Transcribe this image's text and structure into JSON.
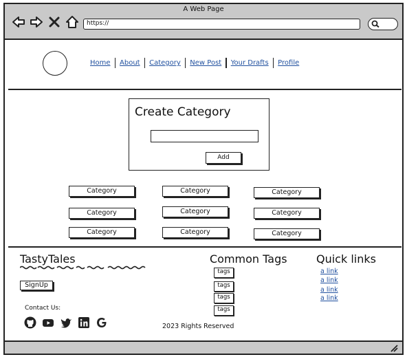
{
  "browser": {
    "window_title": "A Web Page",
    "url": "https://",
    "icons": [
      "back-arrow-icon",
      "forward-arrow-icon",
      "close-icon",
      "home-icon",
      "search-icon"
    ]
  },
  "nav": {
    "items": [
      {
        "label": "Home"
      },
      {
        "label": "About"
      },
      {
        "label": "Category"
      },
      {
        "label": "New Post"
      },
      {
        "label": "Your Drafts"
      },
      {
        "label": "Profile"
      }
    ]
  },
  "create_category": {
    "title": "Create Category",
    "input_value": "",
    "add_label": "Add"
  },
  "categories": [
    "Category",
    "Category",
    "Category",
    "Category",
    "Category",
    "Category",
    "Category",
    "Category",
    "Category"
  ],
  "footer": {
    "brand": "TastyTales",
    "signup_label": "SignUp",
    "contact_label": "Contact Us:",
    "socials": [
      "github-icon",
      "youtube-icon",
      "twitter-icon",
      "linkedin-icon",
      "google-icon"
    ],
    "copyright": "2023 Rights Reserved",
    "common_tags_title": "Common Tags",
    "tags": [
      "tags",
      "tags",
      "tags",
      "tags"
    ],
    "quick_links_title": "Quick links",
    "quick_links": [
      "a link",
      "a link",
      "a link",
      "a link"
    ]
  },
  "colors": {
    "chrome_gray": "#c9c9c9",
    "link_blue": "#1f4f9e",
    "stroke": "#222222"
  }
}
